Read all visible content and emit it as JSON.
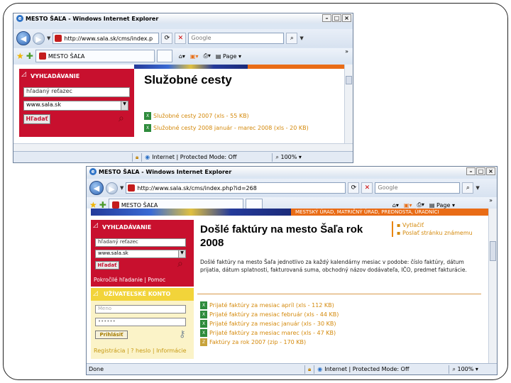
{
  "win1": {
    "title": "MESTO ŠAĽA - Windows Internet Explorer",
    "address": "http://www.sala.sk/cms/index.p",
    "search_placeholder": "Google",
    "tab_label": "MESTO ŠAĽA",
    "page_menu": "Page",
    "sidebar_header": "VYHĽADÁVANIE",
    "search_field": "hľadaný reťazec",
    "select_value": "www.sala.sk",
    "search_button": "Hľadať",
    "page_title": "Služobné cesty",
    "files": [
      {
        "label": "Služobné cesty 2007 (xls - 55 KB)",
        "icon": "excel-file-icon"
      },
      {
        "label": "Služobné cesty 2008 január - marec 2008 (xls - 20 KB)",
        "icon": "excel-file-icon"
      }
    ],
    "status_zone": "Internet | Protected Mode: Off",
    "zoom": "100%"
  },
  "win2": {
    "title": "MESTO ŠAĽA - Windows Internet Explorer",
    "address": "http://www.sala.sk/cms/index.php?id=268",
    "search_placeholder": "Google",
    "tab_label": "MESTO ŠAĽA",
    "page_menu": "Page",
    "banner_text": "MESTSKÝ ÚRAD, MATRIČNÝ ÚRAD, PREDNOSTA, ÚRADNÍCI",
    "sidebar_header": "VYHĽADÁVANIE",
    "search_field": "hľadaný reťazec",
    "select_value": "www.sala.sk",
    "search_button": "Hľadať",
    "adv_links": "Pokročilé hľadanie | Pomoc",
    "account_header": "UŽÍVATEĽSKÉ KONTO",
    "login_field": "Meno",
    "password_field": "••••••",
    "login_button": "Prihlásiť",
    "account_links": "Registrácia | ? heslo | Informácie",
    "page_title": "Došlé faktúry na mesto Šaľa rok 2008",
    "right_links": [
      "Vytlačiť",
      "Poslať stránku známemu"
    ],
    "description": "Došlé faktúry na mesto Šaľa jednotlivo za každý kalendárny mesiac v podobe: číslo faktúry, dátum prijatia, dátum splatnosti, fakturovaná suma, obchodný názov dodávateľa, IČO, predmet fakturácie.",
    "files": [
      {
        "label": "Prijaté faktúry za mesiac apríl (xls - 112 KB)",
        "icon": "excel-file-icon"
      },
      {
        "label": "Prijaté faktúry za mesiac február (xls - 44 KB)",
        "icon": "excel-file-icon"
      },
      {
        "label": "Prijaté faktúry za mesiac január (xls - 30 KB)",
        "icon": "excel-file-icon"
      },
      {
        "label": "Prijaté faktúry za mesiac marec (xls - 47 KB)",
        "icon": "excel-file-icon"
      },
      {
        "label": "Faktúry za rok 2007 (zip - 170 KB)",
        "icon": "zip-file-icon"
      }
    ],
    "status_left": "Done",
    "status_zone": "Internet | Protected Mode: Off",
    "zoom": "100%"
  }
}
